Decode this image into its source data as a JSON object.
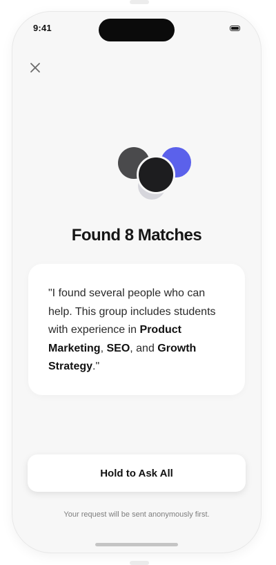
{
  "status_bar": {
    "time": "9:41"
  },
  "header": {
    "close_icon": "close-icon"
  },
  "avatars": {
    "colors": [
      "#4a4a4c",
      "#5b61eb",
      "#1d1d1f",
      "#d6d6dc"
    ]
  },
  "result": {
    "title": "Found 8 Matches"
  },
  "quote": {
    "part1": "\"I found several people who can help. This group includes students with experience in ",
    "skill1": "Product Marketing",
    "sep1": ", ",
    "skill2": "SEO",
    "sep2": ", and ",
    "skill3": "Growth Strategy",
    "end": ".\""
  },
  "actions": {
    "ask_label": "Hold to Ask All"
  },
  "footer": {
    "note": "Your request will be sent anonymously first."
  }
}
